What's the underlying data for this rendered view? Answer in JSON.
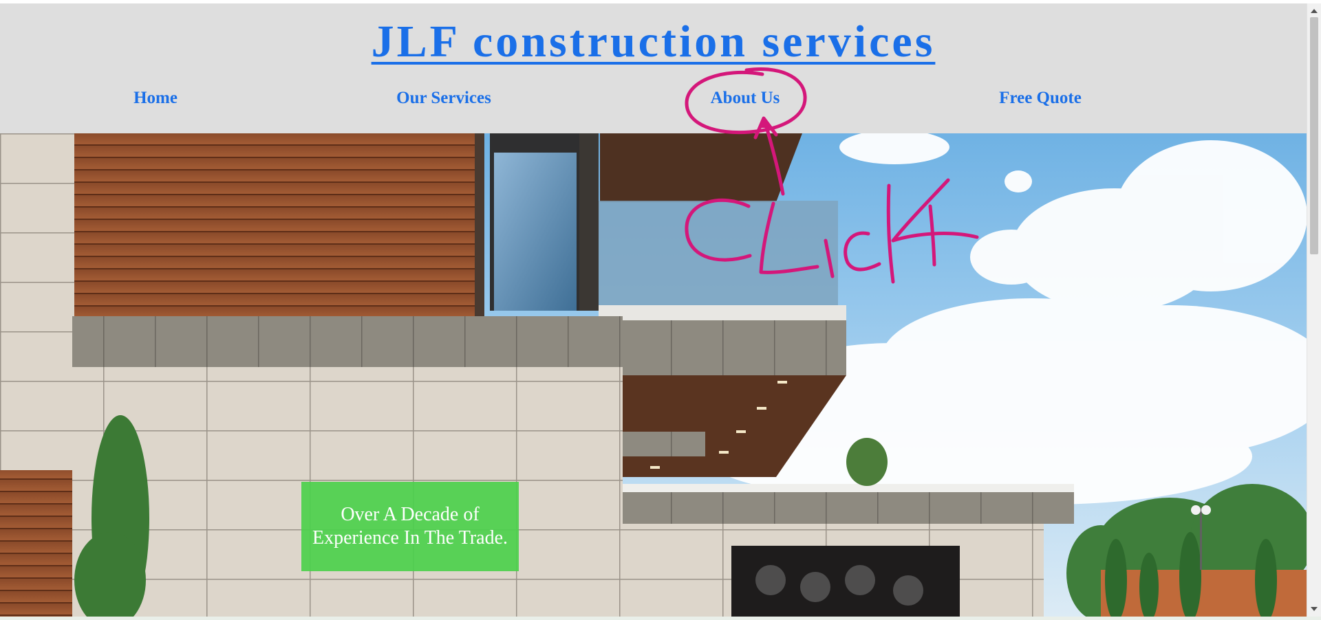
{
  "header": {
    "site_title": "JLF construction services"
  },
  "nav": {
    "items": [
      {
        "label": "Home"
      },
      {
        "label": "Our Services"
      },
      {
        "label": "About Us"
      },
      {
        "label": "Free Quote"
      }
    ]
  },
  "hero": {
    "badge_line1": "Over A Decade of",
    "badge_line2": "Experience In The Trade."
  },
  "annotation": {
    "color": "#d4177a"
  }
}
